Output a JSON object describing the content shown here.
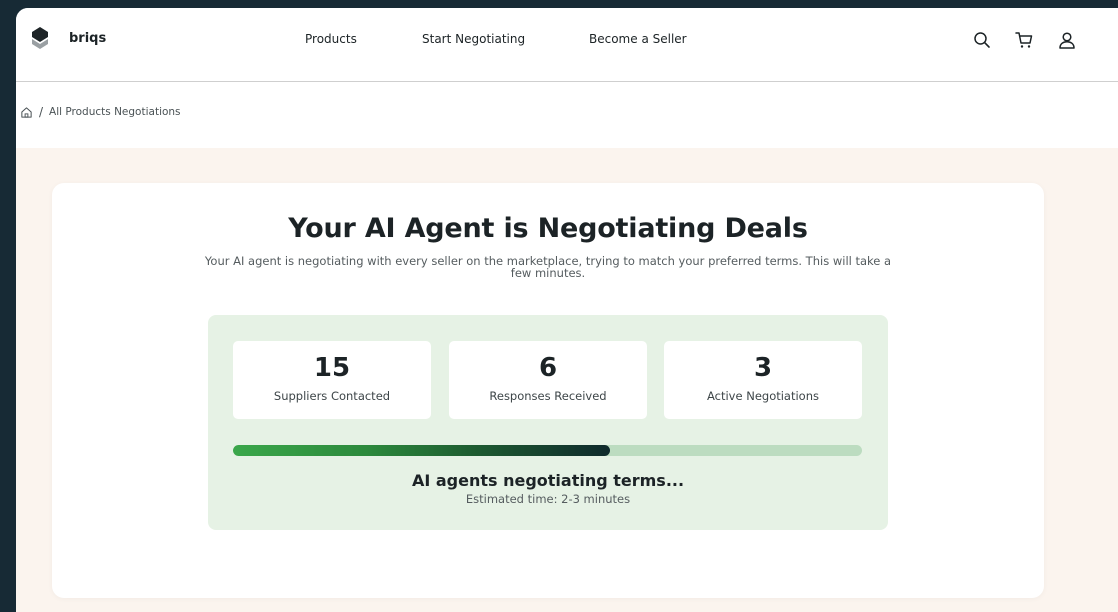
{
  "app": {
    "brand": "briqs"
  },
  "nav": {
    "items": [
      {
        "label": "Products"
      },
      {
        "label": "Start Negotiating"
      },
      {
        "label": "Become a Seller"
      }
    ]
  },
  "header_icons": [
    "search-icon",
    "cart-icon",
    "user-icon"
  ],
  "breadcrumb": {
    "home_icon": "home-icon",
    "separator": "/",
    "current": "All Products Negotiations"
  },
  "main": {
    "title": "Your AI Agent is Negotiating Deals",
    "subtitle": "Your AI agent is negotiating with every seller on the marketplace, trying to match your preferred terms. This will take a few minutes.",
    "stats": [
      {
        "value": "15",
        "label": "Suppliers Contacted"
      },
      {
        "value": "6",
        "label": "Responses Received"
      },
      {
        "value": "3",
        "label": "Active Negotiations"
      }
    ],
    "progress_percent": 60,
    "status_title": "AI agents negotiating terms...",
    "status_subtitle": "Estimated time: 2-3 minutes"
  },
  "colors": {
    "page_bg": "#172a35",
    "main_bg": "#fbf4ee",
    "panel_bg": "#e6f2e5",
    "progress_track": "#bcdcc0",
    "progress_start": "#3aa74a",
    "progress_end": "#0f2a2c"
  }
}
